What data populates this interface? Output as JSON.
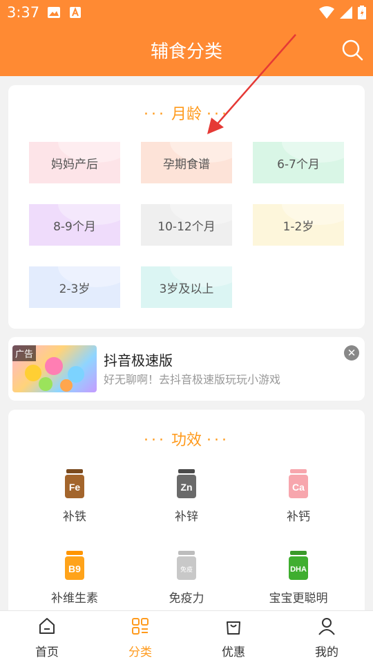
{
  "status_bar": {
    "time": "3:37"
  },
  "app_bar": {
    "title": "辅食分类"
  },
  "age_section": {
    "title": "月龄",
    "items": [
      {
        "label": "妈妈产后",
        "color": "#fde4e8"
      },
      {
        "label": "孕期食谱",
        "color": "#fde3d8"
      },
      {
        "label": "6-7个月",
        "color": "#d9f6e6"
      },
      {
        "label": "8-9个月",
        "color": "#efdcfb"
      },
      {
        "label": "10-12个月",
        "color": "#efefef"
      },
      {
        "label": "1-2岁",
        "color": "#fdf6db"
      },
      {
        "label": "2-3岁",
        "color": "#e3ecfd"
      },
      {
        "label": "3岁及以上",
        "color": "#dbf5f3"
      }
    ]
  },
  "ad": {
    "badge": "广告",
    "title": "抖音极速版",
    "description": "好无聊啊！去抖音极速版玩玩小游戏"
  },
  "effect_section": {
    "title": "功效",
    "items": [
      {
        "label": "补铁",
        "icon_text": "Fe",
        "cap": "#7a4a1e",
        "body": "#a3652c"
      },
      {
        "label": "补锌",
        "icon_text": "Zn",
        "cap": "#4a4a4a",
        "body": "#6a6a6a"
      },
      {
        "label": "补钙",
        "icon_text": "Ca",
        "cap": "#f7a6ad",
        "body": "#f7a6ad"
      },
      {
        "label": "补维生素",
        "icon_text": "B9",
        "cap": "#ff9500",
        "body": "#ffa31a"
      },
      {
        "label": "免疫力",
        "icon_text": "免疫",
        "cap": "#bdbdbd",
        "body": "#c8c8c8"
      },
      {
        "label": "宝宝更聪明",
        "icon_text": "DHA",
        "cap": "#3a9a2a",
        "body": "#3fae2f"
      }
    ]
  },
  "bottom_nav": [
    {
      "label": "首页",
      "active": false
    },
    {
      "label": "分类",
      "active": true
    },
    {
      "label": "优惠",
      "active": false
    },
    {
      "label": "我的",
      "active": false
    }
  ],
  "colors": {
    "primary": "#ff8a33",
    "accent": "#ff9a1c",
    "annotation_arrow": "#e53935"
  }
}
